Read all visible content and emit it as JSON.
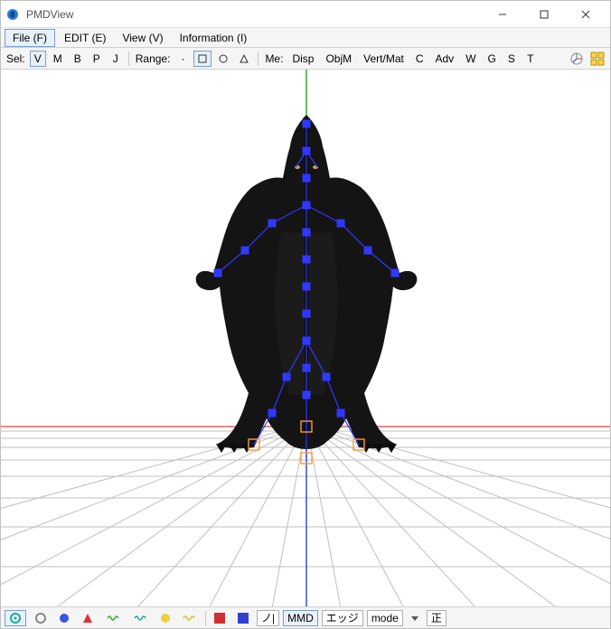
{
  "window": {
    "title": "PMDView"
  },
  "menu": {
    "file": "File (F)",
    "edit": "EDIT (E)",
    "view": "View (V)",
    "info": "Information (I)"
  },
  "toolbar": {
    "sel_label": "Sel:",
    "sel_v": "V",
    "sel_m": "M",
    "sel_b": "B",
    "sel_p": "P",
    "sel_j": "J",
    "range_label": "Range:",
    "me_label": "Me:",
    "me_disp": "Disp",
    "me_objm": "ObjM",
    "me_vertmat": "Vert/Mat",
    "me_c": "C",
    "me_adv": "Adv",
    "me_w": "W",
    "me_g": "G",
    "me_s": "S",
    "me_t": "T"
  },
  "bottom": {
    "mmd": "MMD",
    "edge": "エッジ",
    "mode": "mode",
    "front": "正"
  },
  "colors": {
    "accent": "#3a52e6",
    "bone_blue": "#3030ff",
    "axis_x": "#e03030",
    "axis_y": "#20b020",
    "axis_z": "#3030e0"
  }
}
